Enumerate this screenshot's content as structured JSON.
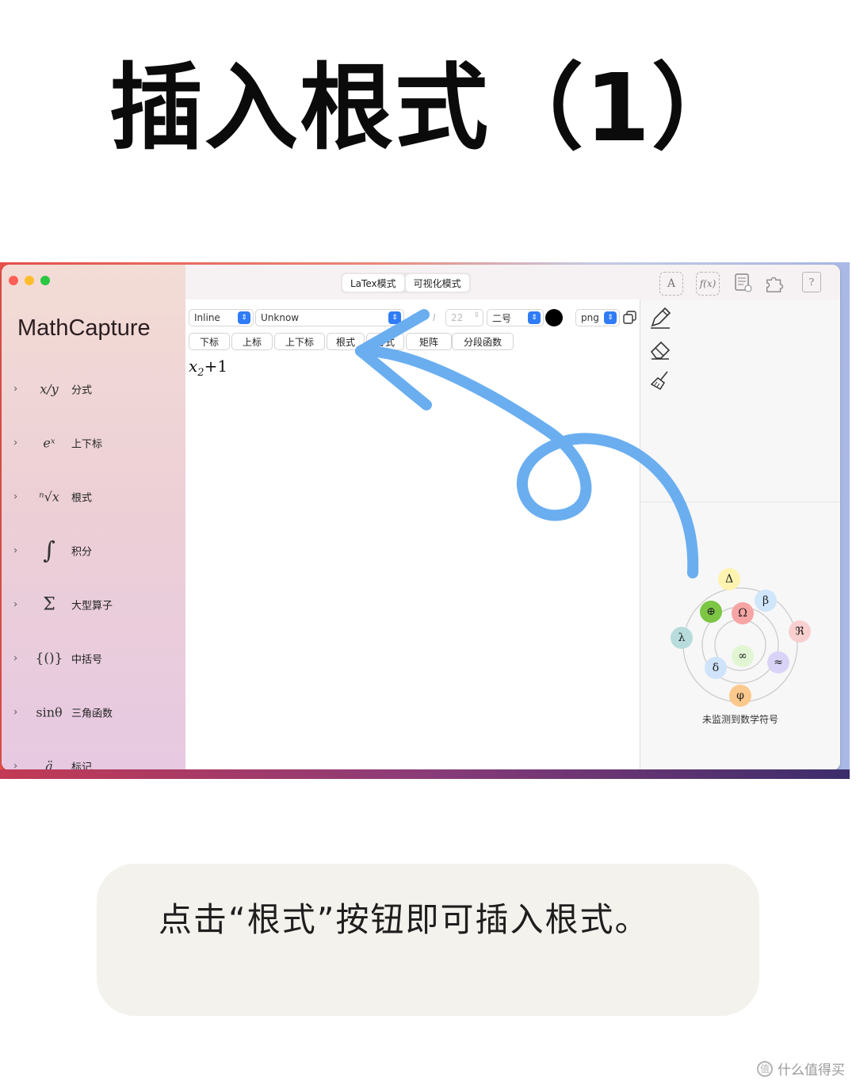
{
  "page": {
    "title": "插入根式（1）",
    "caption": "点击“根式”按钮即可插入根式。",
    "watermark": "值 什么值得买"
  },
  "app": {
    "name": "MathCapture",
    "traffic_colors": [
      "#fe5f57",
      "#febc2e",
      "#28c840"
    ],
    "modes": [
      "LaTex模式",
      "可视化模式"
    ],
    "title_icons": [
      "text-a-icon",
      "function-icon",
      "document-list-icon",
      "puzzle-icon",
      "help-icon"
    ]
  },
  "sidebar": {
    "items": [
      {
        "icon_text": "x/y",
        "label": "分式",
        "icon": "fraction-icon"
      },
      {
        "icon_text": "eˣ",
        "label": "上下标",
        "icon": "superscript-icon"
      },
      {
        "icon_text": "ⁿ√x",
        "label": "根式",
        "icon": "radical-icon"
      },
      {
        "icon_text": "∫",
        "label": "积分",
        "icon": "integral-icon"
      },
      {
        "icon_text": "Σ",
        "label": "大型算子",
        "icon": "sum-icon"
      },
      {
        "icon_text": "{()}",
        "label": "中括号",
        "icon": "brackets-icon"
      },
      {
        "icon_text": "sinθ",
        "label": "三角函数",
        "icon": "trig-icon"
      },
      {
        "icon_text": "ä",
        "label": "标记",
        "icon": "accent-icon"
      }
    ]
  },
  "toolbar": {
    "display_mode": "Inline",
    "font": "Unknow",
    "bold": "B",
    "italic": "I",
    "size": "22",
    "size_name": "二号",
    "color": "#000000",
    "format": "png"
  },
  "tabs": [
    "下标",
    "上标",
    "上下标",
    "根式",
    "分式",
    "矩阵",
    "分段函数"
  ],
  "editor": {
    "formula_base": "x",
    "formula_sub": "2",
    "formula_rest": "+1"
  },
  "tools": [
    "pencil-icon",
    "eraser-icon",
    "broom-icon"
  ],
  "symbol_wheel": {
    "nodes": [
      {
        "symbol": "Δ",
        "color": "#fff3b0"
      },
      {
        "symbol": "β",
        "color": "#cfe6fb"
      },
      {
        "symbol": "ℜ",
        "color": "#f9cfcf"
      },
      {
        "symbol": "≈",
        "color": "#d9d4f7"
      },
      {
        "symbol": "φ",
        "color": "#fbc98d"
      },
      {
        "symbol": "δ",
        "color": "#cfe3fb"
      },
      {
        "symbol": "λ",
        "color": "#b8dcdc"
      },
      {
        "symbol": "⊕",
        "color": "#7cc644"
      },
      {
        "symbol": "Ω",
        "color": "#f7a4a4"
      },
      {
        "symbol": "∞",
        "color": "#e2f6d3"
      }
    ],
    "status": "未监测到数学符号"
  },
  "annotation": {
    "arrow_color": "#6aaef0"
  }
}
